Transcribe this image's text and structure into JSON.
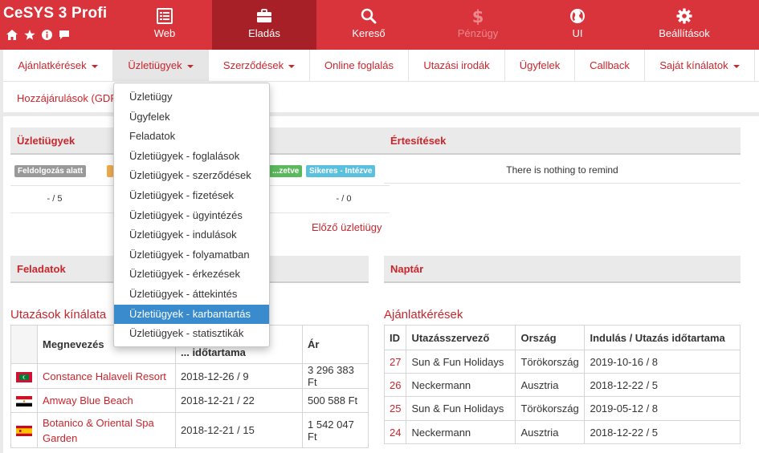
{
  "app": {
    "title": "CeSYS 3 Profi",
    "icons": [
      "home-icon",
      "star-icon",
      "info-icon",
      "chat-icon"
    ]
  },
  "topnav": [
    {
      "label": "Web",
      "icon": "list-icon",
      "state": "normal"
    },
    {
      "label": "Eladás",
      "icon": "briefcase-icon",
      "state": "active"
    },
    {
      "label": "Kereső",
      "icon": "search-icon",
      "state": "normal"
    },
    {
      "label": "Pénzügy",
      "icon": "dollar-icon",
      "state": "disabled"
    },
    {
      "label": "UI",
      "icon": "globe-icon",
      "state": "normal"
    },
    {
      "label": "Beállítások",
      "icon": "gear-icon",
      "state": "normal"
    }
  ],
  "subnav": {
    "items": [
      {
        "label": "Ajánlatkérések",
        "caret": true
      },
      {
        "label": "Üzletiügyek",
        "caret": true
      },
      {
        "label": "Szerződések",
        "caret": true
      },
      {
        "label": "Online foglalás",
        "caret": false
      },
      {
        "label": "Utazási irodák",
        "caret": false
      },
      {
        "label": "Ügyfelek",
        "caret": false
      },
      {
        "label": "Callback",
        "caret": false
      },
      {
        "label": "Saját kínálatok",
        "caret": true
      }
    ],
    "second_row": "Hozzájárulások (GDPR)"
  },
  "dropdown": {
    "items": [
      "Üzletiügy",
      "Ügyfelek",
      "Feladatok",
      "Üzletiügyek - foglalások",
      "Üzletiügyek - szerződések",
      "Üzletiügyek - fizetések",
      "Üzletiügyek - ügyintézés",
      "Üzletiügyek - indulások",
      "Üzletiügyek - folyamatban",
      "Üzletiügyek - érkezések",
      "Üzletiügyek - áttekintés",
      "Üzletiügyek - karbantartás",
      "Üzletiügyek - statisztikák"
    ],
    "highlighted": "Üzletiügyek - karbantartás"
  },
  "panels": {
    "business": {
      "title": "Üzletiügyek",
      "badges": [
        {
          "label": "Feldolgozás alatt",
          "color": "#999999"
        },
        {
          "label": "...",
          "color": "#f0ad4e"
        },
        {
          "label": "...zetve",
          "color": "#5cb85c"
        },
        {
          "label": "Sikeres - Intézve",
          "color": "#5bc0de"
        }
      ],
      "counts": [
        "- / 5",
        "- / 0"
      ],
      "prev_link": "Előző üzletiügy"
    },
    "notifications": {
      "title": "Értesítések",
      "empty": "There is nothing to remind"
    },
    "tasks": {
      "title": "Feladatok"
    },
    "calendar": {
      "title": "Naptár"
    }
  },
  "offers": {
    "title": "Utazások kínálata",
    "headers": [
      "Megnevezés",
      "... időtartama",
      "Ár"
    ],
    "rows": [
      {
        "flag": "maldives",
        "name": "Constance Halaveli Resort",
        "date": "2018-12-26 / 9",
        "price": "3 296 383 Ft"
      },
      {
        "flag": "egypt",
        "name": "Amway Blue Beach",
        "date": "2018-12-21 / 22",
        "price": "500 588 Ft"
      },
      {
        "flag": "spain",
        "name": "Botanico & Oriental Spa Garden",
        "date": "2018-12-21 / 15",
        "price": "1 542 047 Ft"
      }
    ]
  },
  "requests": {
    "title": "Ajánlatkérések",
    "headers": [
      "ID",
      "Utazásszervező",
      "Ország",
      "Indulás / Utazás időtartama"
    ],
    "rows": [
      {
        "id": "27",
        "org": "Sun & Fun Holidays",
        "country": "Törökország",
        "date": "2019-10-16 / 8"
      },
      {
        "id": "26",
        "org": "Neckermann",
        "country": "Ausztria",
        "date": "2018-12-22 / 5"
      },
      {
        "id": "25",
        "org": "Sun & Fun Holidays",
        "country": "Törökország",
        "date": "2019-05-12 / 8"
      },
      {
        "id": "24",
        "org": "Neckermann",
        "country": "Ausztria",
        "date": "2018-12-22 / 5"
      }
    ]
  }
}
